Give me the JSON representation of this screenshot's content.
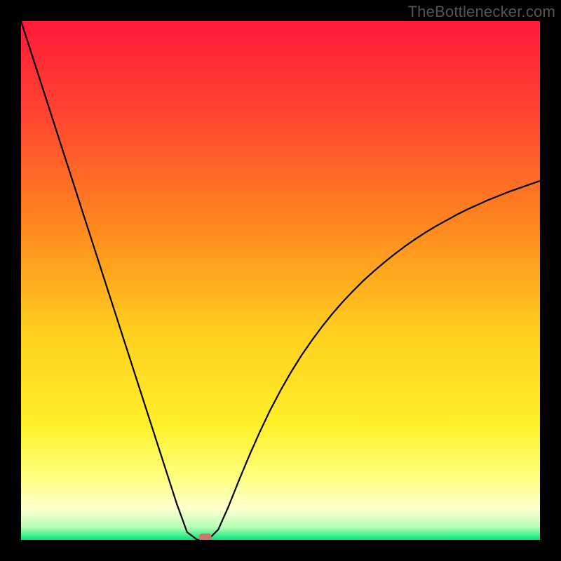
{
  "watermark": "TheBottlenecker.com",
  "chart_data": {
    "type": "line",
    "title": "",
    "xlabel": "",
    "ylabel": "",
    "xlim": [
      0,
      100
    ],
    "ylim": [
      0,
      100
    ],
    "grid": false,
    "axes_visible": false,
    "background_gradient": {
      "stops": [
        {
          "pos": 0.0,
          "color": "#ff1a3a"
        },
        {
          "pos": 0.2,
          "color": "#ff4a2e"
        },
        {
          "pos": 0.4,
          "color": "#ff8a1f"
        },
        {
          "pos": 0.6,
          "color": "#ffcf1f"
        },
        {
          "pos": 0.78,
          "color": "#fff02a"
        },
        {
          "pos": 0.88,
          "color": "#ffff80"
        },
        {
          "pos": 0.94,
          "color": "#ffffd0"
        },
        {
          "pos": 0.975,
          "color": "#b8ffb8"
        },
        {
          "pos": 1.0,
          "color": "#00e676"
        }
      ]
    },
    "series": [
      {
        "name": "bottleneck-curve",
        "type": "line",
        "color": "#000000",
        "width": 2.2,
        "x": [
          0,
          2,
          4,
          6,
          8,
          10,
          12,
          14,
          16,
          18,
          20,
          22,
          24,
          26,
          28,
          30,
          32,
          34,
          36,
          38,
          40,
          42,
          44,
          46,
          48,
          50,
          52,
          54,
          56,
          58,
          60,
          62,
          64,
          66,
          68,
          70,
          72,
          74,
          76,
          78,
          80,
          82,
          84,
          86,
          88,
          90,
          92,
          94,
          96,
          98,
          100
        ],
        "y": [
          100,
          93.8,
          87.6,
          81.4,
          75.2,
          69.0,
          62.8,
          56.6,
          50.4,
          44.2,
          38.0,
          31.8,
          25.6,
          19.4,
          13.2,
          7.0,
          1.5,
          0.0,
          0.0,
          2.0,
          6.5,
          11.5,
          16.3,
          20.8,
          25.0,
          28.8,
          32.3,
          35.5,
          38.4,
          41.1,
          43.6,
          45.9,
          48.0,
          50.0,
          51.8,
          53.5,
          55.1,
          56.6,
          58.0,
          59.3,
          60.5,
          61.6,
          62.7,
          63.7,
          64.6,
          65.5,
          66.3,
          67.1,
          67.8,
          68.5,
          69.2
        ]
      }
    ],
    "marker": {
      "name": "optimal-point",
      "x": 35.5,
      "y": 0.5,
      "shape": "rounded-rect",
      "color": "#c97a6a",
      "width": 2.4,
      "height": 1.5
    }
  }
}
